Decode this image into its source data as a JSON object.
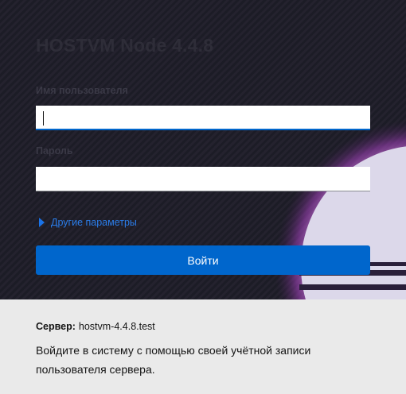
{
  "app": {
    "title": "HOSTVM Node 4.4.8"
  },
  "form": {
    "username_label": "Имя пользователя",
    "username_value": "",
    "password_label": "Пароль",
    "password_value": "",
    "advanced_label": "Другие параметры",
    "login_label": "Войти"
  },
  "server": {
    "key": "Сервер:",
    "host": "hostvm-4.4.8.test",
    "message": "Войдите в систему с помощью своей учётной записи пользователя сервера."
  },
  "colors": {
    "accent": "#0066cc",
    "link": "#2b7de9",
    "background_dark": "#1c1c26",
    "info_background": "#eaeaea"
  },
  "icons": {
    "advanced": "caret-right-icon",
    "decor": "planet-decoration"
  }
}
